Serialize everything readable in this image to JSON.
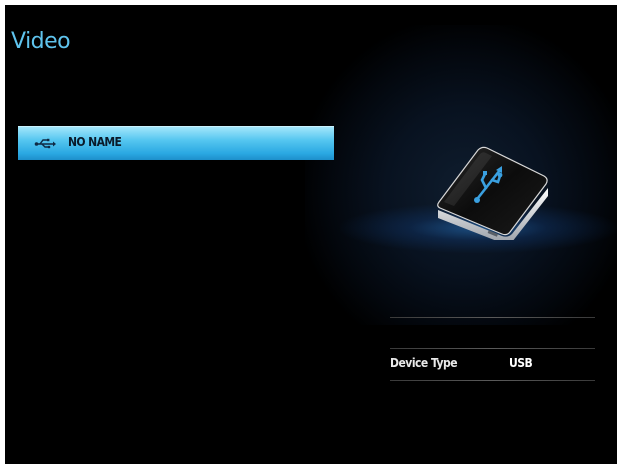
{
  "header": {
    "title": "Video"
  },
  "devices": [
    {
      "icon": "usb-icon",
      "label": "NO NAME",
      "selected": true
    }
  ],
  "illustration": {
    "icon": "usb-hard-drive-icon"
  },
  "info": {
    "rows": [
      {
        "label": "Device Type",
        "value": "USB"
      }
    ]
  },
  "colors": {
    "background": "#000000",
    "title": "#5fc4ee",
    "highlight": "#3ab6ea",
    "usb_symbol": "#3aa0e0",
    "divider": "#4a4a4a"
  }
}
